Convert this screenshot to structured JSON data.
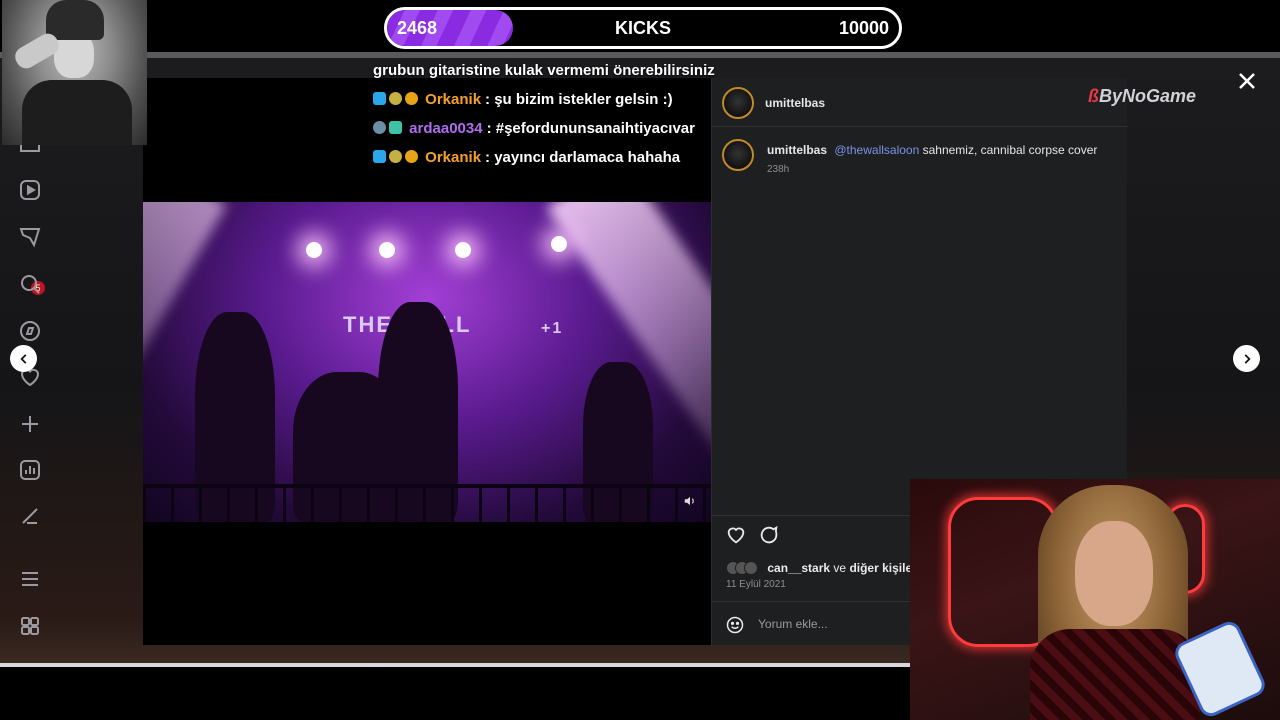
{
  "kicks_bar": {
    "current": "2468",
    "label": "KICKS",
    "goal": "10000",
    "progress_fraction": 0.2468
  },
  "chat": [
    {
      "user": "",
      "user_color": "#ffffff",
      "message": "grubun gitaristine kulak vermemi önerebilirsiniz"
    },
    {
      "user": "Orkanik",
      "user_color": "#f4a12a",
      "message": ": şu bizim istekler gelsin :)"
    },
    {
      "user": "ardaa0034",
      "user_color": "#b06cf0",
      "message": ": #şefordununsanaihtiyacıvar"
    },
    {
      "user": "Orkanik",
      "user_color": "#f4a12a",
      "message": ": yayıncı darlamaca hahaha"
    }
  ],
  "sidebar": {
    "notification_count": "5",
    "icons": [
      "home-icon",
      "reels-icon",
      "messages-icon",
      "search-icon",
      "explore-icon",
      "heart-icon",
      "create-icon",
      "dashboard-icon",
      "threads-icon",
      "menu-icon",
      "apps-icon"
    ]
  },
  "post": {
    "header_username": "umittelbas",
    "caption_username": "umittelbas",
    "caption_mention": "@thewallsaloon",
    "caption_text": "sahnemiz, cannibal corpse cover",
    "time_ago": "238h",
    "likes_user": "can__stark",
    "likes_connector": "ve",
    "likes_others": "diğer kişiler b",
    "date": "11 Eylül 2021",
    "comment_placeholder": "Yorum ekle..."
  },
  "video": {
    "venue_sign": "THE WALL",
    "sign_badge": "+1"
  },
  "logo": {
    "mark": "ß",
    "text": "ByNoGame"
  },
  "colors": {
    "kicks_fill": "#8a2be2",
    "panel_bg": "#1e1f21",
    "mention": "#7b93e8",
    "badge": "#c1121f"
  }
}
